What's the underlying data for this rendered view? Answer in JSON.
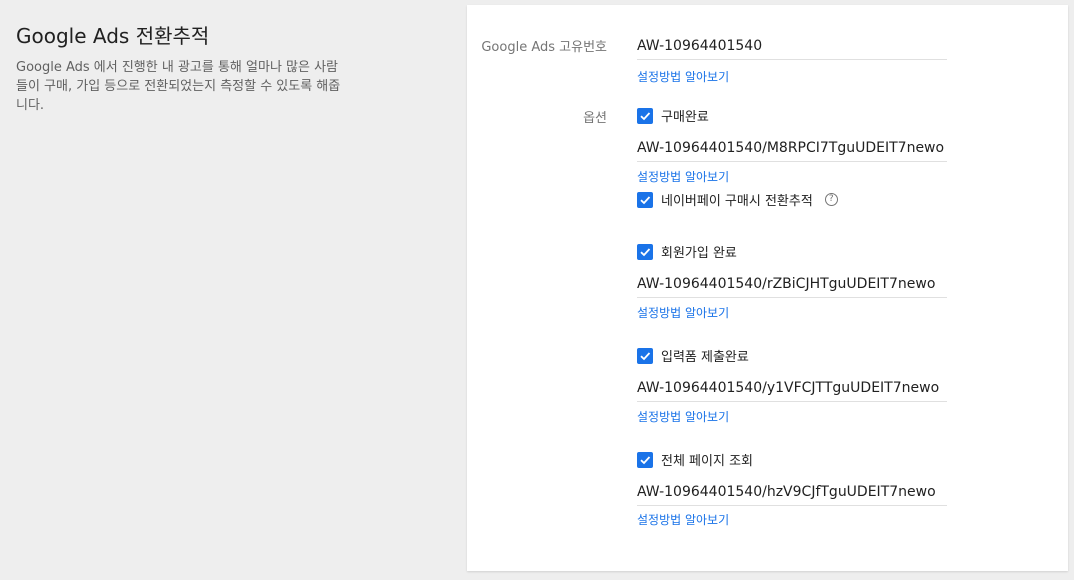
{
  "header": {
    "title": "Google Ads 전환추적",
    "description": "Google Ads 에서 진행한 내 광고를 통해 얼마나 많은 사람들이 구매, 가입 등으로 전환되었는지 측정할 수 있도록 해줍니다."
  },
  "id_section": {
    "label": "Google Ads 고유번호",
    "value": "AW-10964401540",
    "help_link": "설정방법 알아보기"
  },
  "options": {
    "label": "옵션",
    "items": [
      {
        "label": "구매완료",
        "checked": true,
        "value": "AW-10964401540/M8RPCI7TguUDEIT7newo",
        "help_link": "설정방법 알아보기"
      },
      {
        "label": "네이버페이 구매시 전환추적",
        "checked": true,
        "help_icon": "question-circle-icon"
      },
      {
        "label": "회원가입 완료",
        "checked": true,
        "value": "AW-10964401540/rZBiCJHTguUDEIT7newo",
        "help_link": "설정방법 알아보기"
      },
      {
        "label": "입력폼 제출완료",
        "checked": true,
        "value": "AW-10964401540/y1VFCJTTguUDEIT7newo",
        "help_link": "설정방법 알아보기"
      },
      {
        "label": "전체 페이지 조회",
        "checked": true,
        "value": "AW-10964401540/hzV9CJfTguUDEIT7newo",
        "help_link": "설정방법 알아보기"
      }
    ]
  },
  "colors": {
    "accent": "#1a73e8",
    "background": "#eeeeee",
    "card": "#ffffff"
  }
}
